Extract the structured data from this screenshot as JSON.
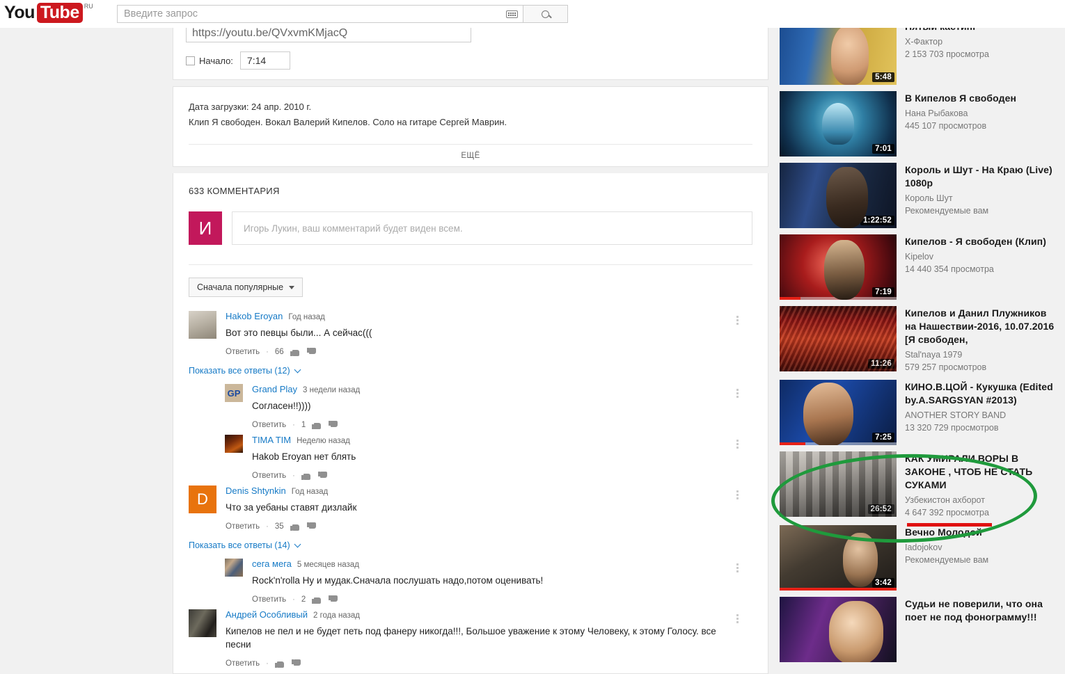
{
  "masthead": {
    "logo_you": "You",
    "logo_tube": "Tube",
    "logo_country": "RU",
    "search_placeholder": "Введите запрос",
    "search_value": "",
    "keyboard_icon": "keyboard-icon",
    "search_icon": "search-icon"
  },
  "share_panel": {
    "url_value": "https://youtu.be/QVxvmKMjacQ",
    "start_checkbox_label": "Начало:",
    "start_time_value": "7:14"
  },
  "description": {
    "upload_date": "Дата загрузки: 24 апр. 2010 г.",
    "text": "Клип Я свободен. Вокал Валерий Кипелов. Соло на гитаре Сергей Маврин.",
    "more_label": "ЕЩЁ"
  },
  "comments": {
    "count_label": "633 КОММЕНТАРИЯ",
    "compose_placeholder": "Игорь Лукин, ваш комментарий будет виден всем.",
    "me_avatar_letter": "И",
    "me_avatar_color": "#c2185b",
    "sort_label": "Сначала популярные",
    "reply_label": "Ответить",
    "items": [
      {
        "author": "Hakob Eroyan",
        "time": "Год назад",
        "text": "Вот это певцы были... А сейчас(((",
        "likes": "66",
        "show_replies": "Показать все ответы (12)",
        "avatar_class": "ava-seal",
        "avatar_letter": "",
        "replies": [
          {
            "author": "Grand Play",
            "time": "3 недели назад",
            "text": "Согласен!!))))",
            "likes": "1",
            "avatar_class": "ava-gp",
            "avatar_letter": ""
          },
          {
            "author": "TIMA TIM",
            "time": "Неделю назад",
            "text": "Hakob Eroyan нет блять",
            "likes": "",
            "avatar_class": "ava-tima",
            "avatar_letter": ""
          }
        ]
      },
      {
        "author": "Denis Shtynkin",
        "time": "Год назад",
        "text": "Что за уебаны ставят дизлайк",
        "likes": "35",
        "show_replies": "Показать все ответы (14)",
        "avatar_class": "ava-d",
        "avatar_letter": "D",
        "replies": [
          {
            "author": "сега мега",
            "time": "5 месяцев назад",
            "text": "Rock'n'rolla Ну и мудак.Сначала послушать надо,потом оценивать!",
            "likes": "2",
            "avatar_class": "ava-sega",
            "avatar_letter": ""
          }
        ]
      },
      {
        "author": "Андрей Особливый",
        "time": "2 года назад",
        "text": "Кипелов не пел и не будет петь под фанеру никогда!!!, Большое уважение к этому Человеку, к этому Голосу.  все песни",
        "likes": "",
        "show_replies": "",
        "avatar_class": "ava-andrey",
        "avatar_letter": "",
        "replies": []
      }
    ]
  },
  "sidebar": {
    "items": [
      {
        "title": "Пятый кастинг",
        "channel": "Х-Фактор",
        "views": "2 153 703 просмотра",
        "duration": "5:48",
        "thumb_class": "th1",
        "progress": 0
      },
      {
        "title": "В Кипелов Я свободен",
        "channel": "Нана Рыбакова",
        "views": "445 107 просмотров",
        "duration": "7:01",
        "thumb_class": "th2",
        "progress": 0
      },
      {
        "title": "Король и Шут - На Краю (Live) 1080p",
        "channel": "Король Шут",
        "views": "Рекомендуемые вам",
        "duration": "1:22:52",
        "thumb_class": "th3",
        "progress": 0
      },
      {
        "title": "Кипелов - Я свободен (Клип)",
        "channel": "Kipelov",
        "views": "14 440 354 просмотра",
        "duration": "7:19",
        "thumb_class": "th4",
        "progress": 18
      },
      {
        "title": "Кипелов и Данил Плужников на Нашествии-2016, 10.07.2016 [Я свободен,",
        "channel": "Stal'naya 1979",
        "views": "579 257 просмотров",
        "duration": "11:26",
        "thumb_class": "th5",
        "progress": 0
      },
      {
        "title": "КИНО.В.ЦОЙ - Кукушка (Edited by.A.SARGSYAN #2013)",
        "channel": "ANOTHER STORY BAND",
        "views": "13 320 729 просмотров",
        "duration": "7:25",
        "thumb_class": "th6",
        "progress": 22
      },
      {
        "title": "КАК УМИРАЛИ ВОРЫ В ЗАКОНЕ , ЧТОБ НЕ СТАТЬ СУКАМИ",
        "channel": "Узбекистон ахборот",
        "views": "4 647 392 просмотра",
        "duration": "26:52",
        "thumb_class": "th7",
        "progress": 0
      },
      {
        "title": "Вечно Молодой",
        "channel": "Iadojokov",
        "views": "Рекомендуемые вам",
        "duration": "3:42",
        "thumb_class": "th8",
        "progress": 100
      },
      {
        "title": "Судьи не поверили, что она поет не под фонограмму!!!",
        "channel": "",
        "views": "",
        "duration": "",
        "thumb_class": "th9",
        "progress": 0
      }
    ]
  },
  "annotations": {
    "ellipse_color": "#1f9a3c",
    "underline_color": "#e01010",
    "highlighted_item_index": 6
  }
}
